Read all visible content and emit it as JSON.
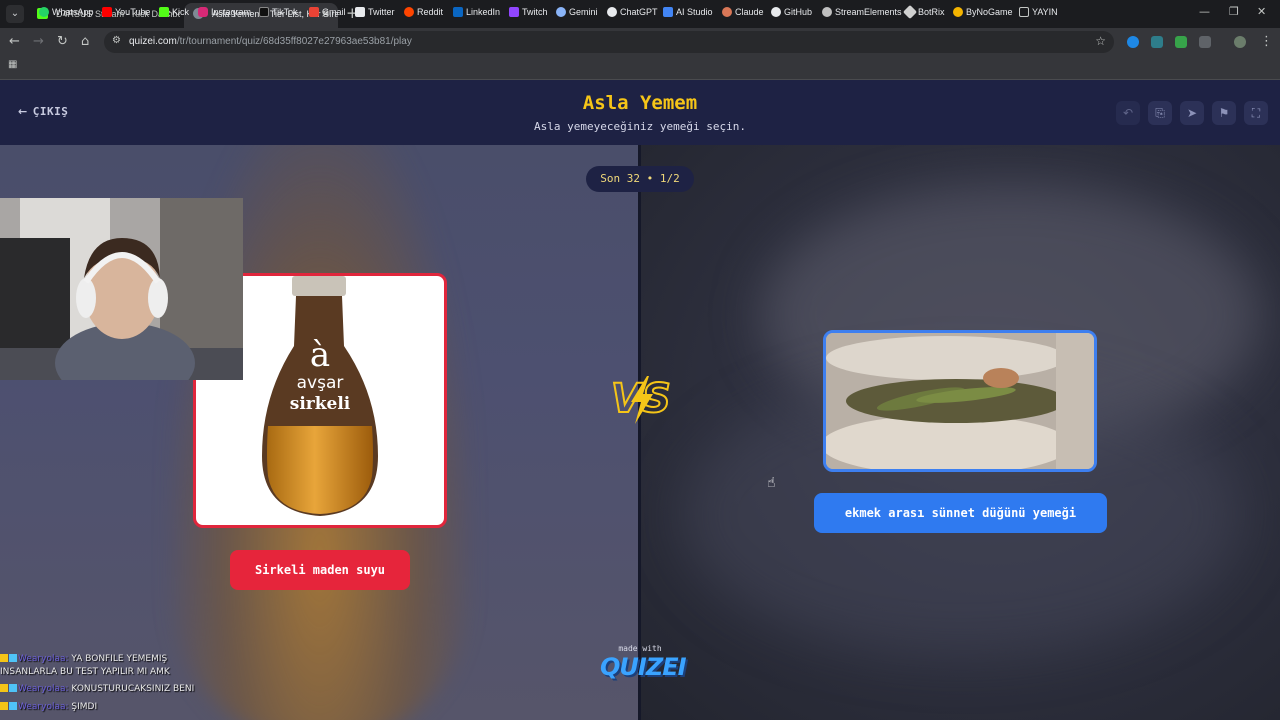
{
  "browser": {
    "tabs": [
      {
        "title": "D4RSUS Stream - Kick Dashboard"
      },
      {
        "title": "Asla Yemem - Tier List, Kör Sıralama"
      }
    ],
    "url_host": "quizei.com",
    "url_path": "/tr/tournament/quiz/68d35ff8027e27963ae53b81/play",
    "bookmarks": [
      "WhatsApp",
      "YouTube",
      "Kick",
      "Instagram",
      "TikTok",
      "Gmail",
      "Twitter",
      "Reddit",
      "LinkedIn",
      "Twitch",
      "Gemini",
      "ChatGPT",
      "AI Studio",
      "Claude",
      "GitHub",
      "StreamElements",
      "BotRix",
      "ByNoGame",
      "YAYIN"
    ]
  },
  "header": {
    "exit_label": "ÇIKIŞ",
    "title": "Asla Yemem",
    "subtitle": "Asla yemeyeceğiniz yemeği seçin."
  },
  "round": {
    "badge": "Son 32 • 1/2"
  },
  "options": {
    "left_label": "Sirkeli maden suyu",
    "right_label": "ekmek arası sünnet düğünü yemeği"
  },
  "bottle_text": {
    "brand": "avşar",
    "sub": "sirkeli"
  },
  "chat": [
    {
      "user": "Wearyolaa:",
      "text": "YA BONFILE YEMEMIŞ"
    },
    {
      "user": "",
      "text": "INSANLARLA BU TEST YAPILIR MI AMK"
    },
    {
      "user": "Wearyolaa:",
      "text": "KONUSTURUCAKSINIZ BENI"
    },
    {
      "user": "Wearyolaa:",
      "text": "ŞIMDI"
    }
  ],
  "footer": {
    "made_with": "made with",
    "logo": "QUIZEI"
  },
  "colors": {
    "accent_left": "#e6253b",
    "accent_right": "#2f7af0",
    "title": "#f5c518",
    "header_bg": "#1e2244"
  }
}
